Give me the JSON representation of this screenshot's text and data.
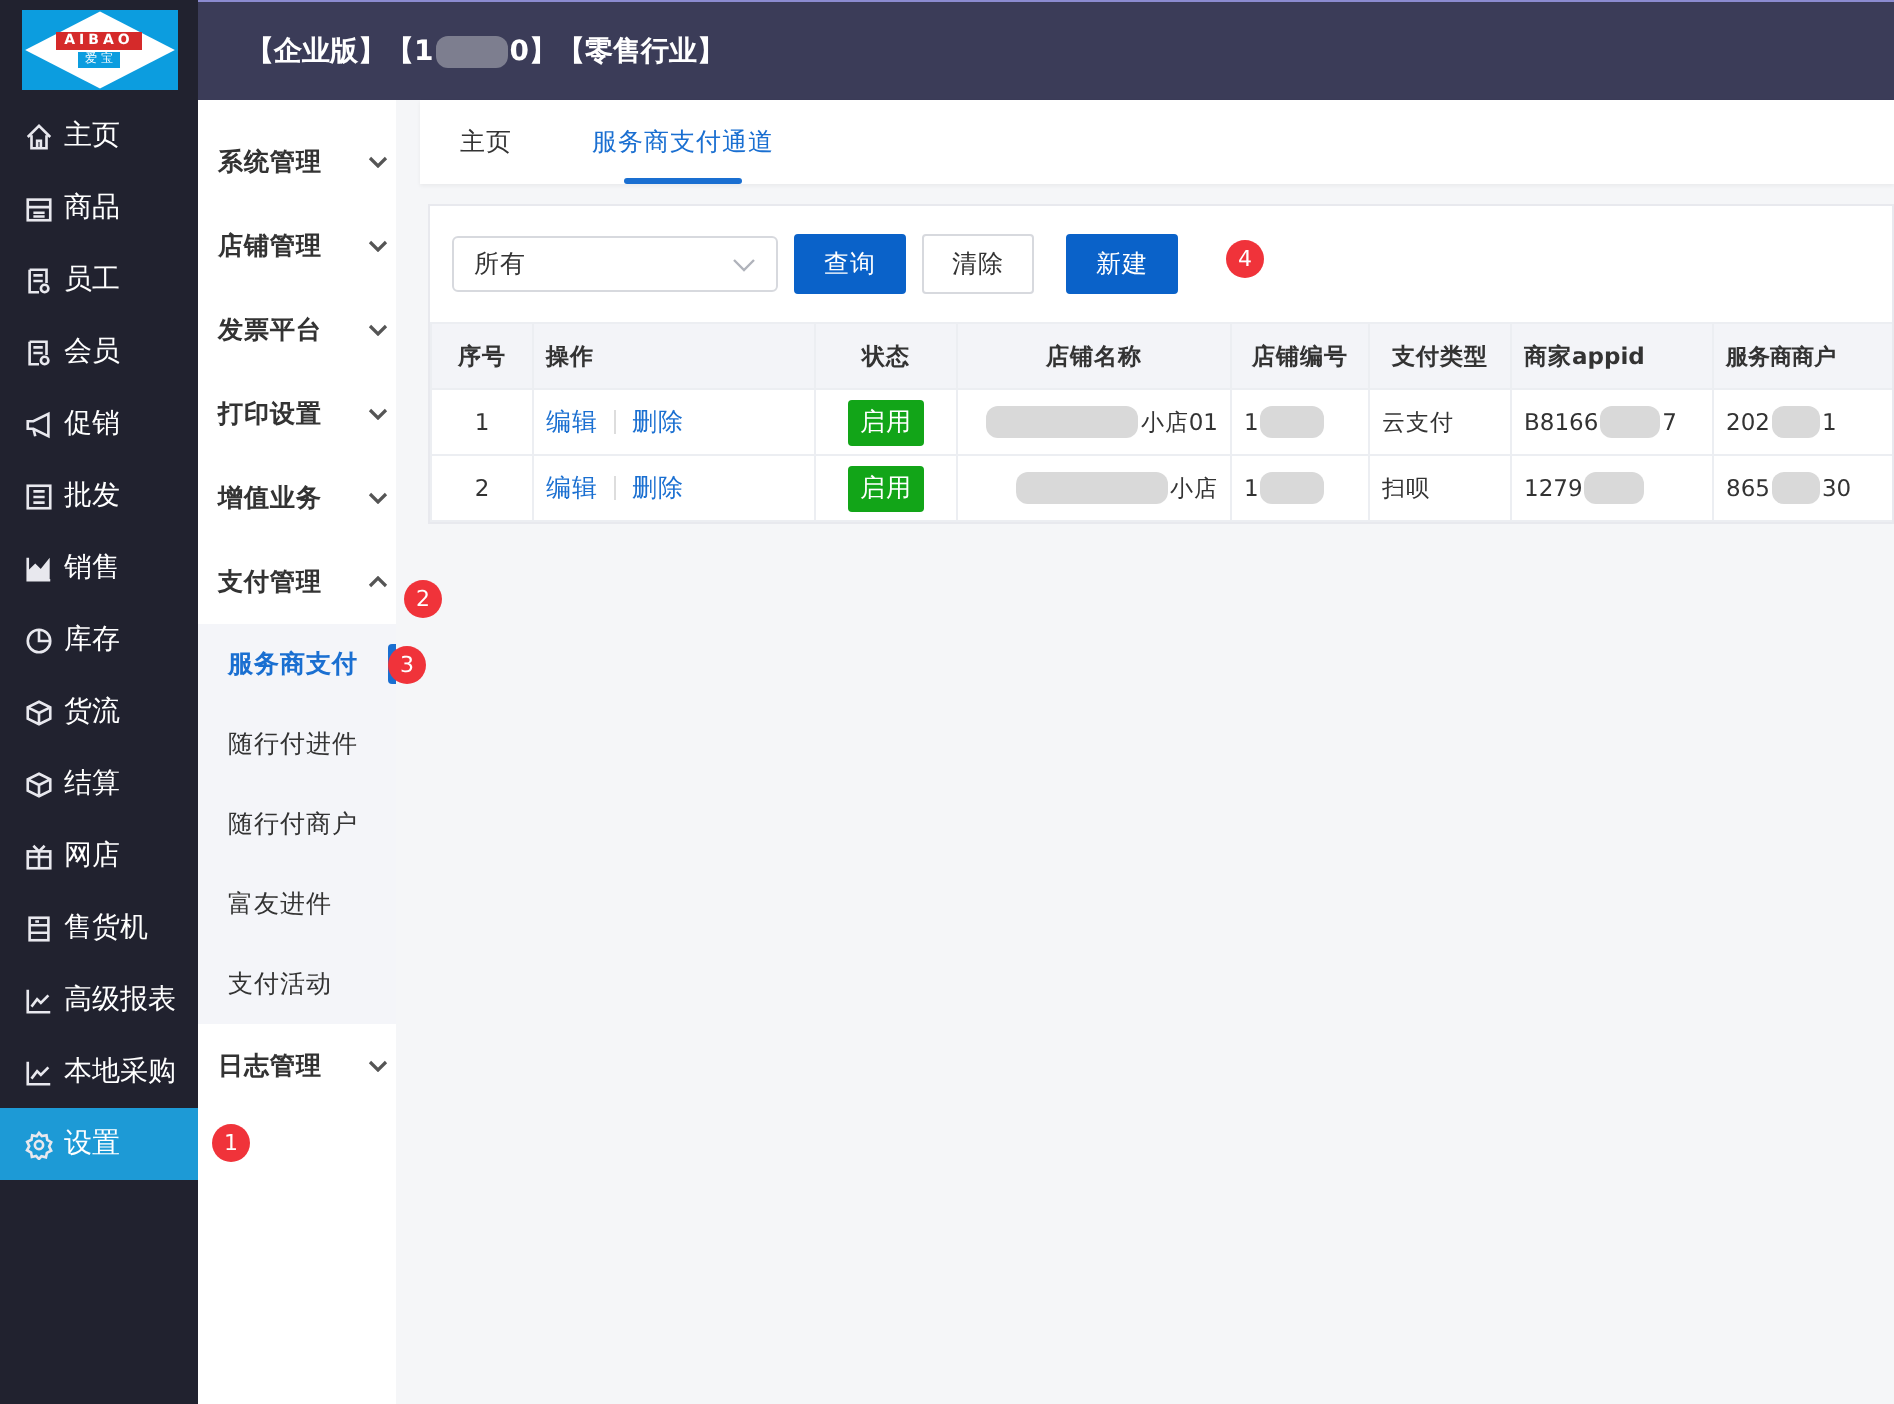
{
  "logo": {
    "brand": "AIBAO",
    "subtitle": "爱 宝"
  },
  "header": {
    "title_parts": [
      {
        "kind": "text",
        "text": "【企业版】【1"
      },
      {
        "kind": "blur"
      },
      {
        "kind": "text",
        "text": "0】【零售行业】"
      }
    ]
  },
  "main_menu": [
    {
      "label": "主页",
      "selected": false
    },
    {
      "label": "商品",
      "selected": false
    },
    {
      "label": "员工",
      "selected": false
    },
    {
      "label": "会员",
      "selected": false
    },
    {
      "label": "促销",
      "selected": false
    },
    {
      "label": "批发",
      "selected": false
    },
    {
      "label": "销售",
      "selected": false
    },
    {
      "label": "库存",
      "selected": false
    },
    {
      "label": "货流",
      "selected": false
    },
    {
      "label": "结算",
      "selected": false
    },
    {
      "label": "网店",
      "selected": false
    },
    {
      "label": "售货机",
      "selected": false
    },
    {
      "label": "高级报表",
      "selected": false
    },
    {
      "label": "本地采购",
      "selected": false
    },
    {
      "label": "设置",
      "selected": true
    }
  ],
  "sub_menu": [
    {
      "label": "系统管理",
      "expanded": false
    },
    {
      "label": "店铺管理",
      "expanded": false
    },
    {
      "label": "发票平台",
      "expanded": false
    },
    {
      "label": "打印设置",
      "expanded": false
    },
    {
      "label": "增值业务",
      "expanded": false
    },
    {
      "label": "支付管理",
      "expanded": true,
      "children": [
        {
          "label": "服务商支付",
          "selected": true
        },
        {
          "label": "随行付进件",
          "selected": false
        },
        {
          "label": "随行付商户",
          "selected": false
        },
        {
          "label": "富友进件",
          "selected": false
        },
        {
          "label": "支付活动",
          "selected": false
        }
      ]
    },
    {
      "label": "日志管理",
      "expanded": false
    }
  ],
  "tabs": [
    {
      "label": "主页",
      "selected": false
    },
    {
      "label": "服务商支付通道",
      "selected": true
    }
  ],
  "filter": {
    "select": {
      "value": "所有"
    },
    "buttons": [
      {
        "label": "查询",
        "kind": "primary"
      },
      {
        "label": "清除",
        "kind": "plain"
      },
      {
        "label": "新建",
        "kind": "primary"
      }
    ]
  },
  "table": {
    "columns": [
      "序号",
      "操作",
      "状态",
      "店铺名称",
      "店铺编号",
      "支付类型",
      "商家appid",
      "服务商商户"
    ],
    "rows": [
      {
        "index": "1",
        "actions": [
          "编辑",
          "删除"
        ],
        "status": {
          "label": "启用",
          "enabled": true
        },
        "store_name": [
          {
            "kind": "blur"
          },
          {
            "kind": "text",
            "text": "小店01"
          }
        ],
        "store_code": [
          {
            "kind": "text",
            "text": "1"
          },
          {
            "kind": "blur"
          }
        ],
        "pay_type": [
          {
            "kind": "text",
            "text": "云支付"
          }
        ],
        "appid": [
          {
            "kind": "text",
            "text": "B8166"
          },
          {
            "kind": "blur"
          },
          {
            "kind": "text",
            "text": "7"
          }
        ],
        "provider_merchant": [
          {
            "kind": "text",
            "text": "202"
          },
          {
            "kind": "blur"
          },
          {
            "kind": "text",
            "text": "1"
          }
        ]
      },
      {
        "index": "2",
        "actions": [
          "编辑",
          "删除"
        ],
        "status": {
          "label": "启用",
          "enabled": true
        },
        "store_name": [
          {
            "kind": "blur"
          },
          {
            "kind": "text",
            "text": "小店"
          }
        ],
        "store_code": [
          {
            "kind": "text",
            "text": "1"
          },
          {
            "kind": "blur"
          }
        ],
        "pay_type": [
          {
            "kind": "text",
            "text": "扫呗"
          }
        ],
        "appid": [
          {
            "kind": "text",
            "text": "1279"
          },
          {
            "kind": "blur"
          }
        ],
        "provider_merchant": [
          {
            "kind": "text",
            "text": "865"
          },
          {
            "kind": "blur"
          },
          {
            "kind": "text",
            "text": "30"
          }
        ]
      }
    ]
  },
  "annotations": [
    {
      "text": "1"
    },
    {
      "text": "2"
    },
    {
      "text": "3"
    },
    {
      "text": "4"
    }
  ]
}
